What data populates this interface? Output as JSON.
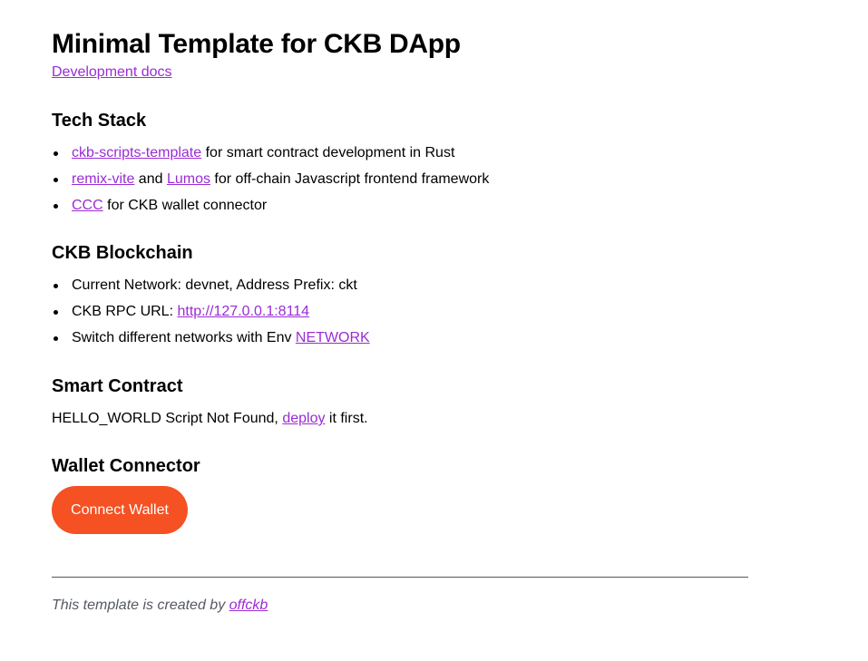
{
  "header": {
    "title": "Minimal Template for CKB DApp",
    "docs_link": "Development docs"
  },
  "tech_stack": {
    "heading": "Tech Stack",
    "items": [
      {
        "link": "ckb-scripts-template",
        "text": " for smart contract development in Rust"
      },
      {
        "link1": "remix-vite",
        "mid": " and ",
        "link2": "Lumos",
        "text": " for off-chain Javascript frontend framework"
      },
      {
        "link": "CCC",
        "text": " for CKB wallet connector"
      }
    ]
  },
  "blockchain": {
    "heading": "CKB Blockchain",
    "items": [
      {
        "text": "Current Network: devnet, Address Prefix: ckt"
      },
      {
        "text": "CKB RPC URL: ",
        "link": "http://127.0.0.1:8114"
      },
      {
        "text": "Switch different networks with Env ",
        "link": "NETWORK"
      }
    ]
  },
  "smart_contract": {
    "heading": "Smart Contract",
    "text_before": "HELLO_WORLD Script Not Found, ",
    "link": "deploy",
    "text_after": " it first."
  },
  "wallet": {
    "heading": "Wallet Connector",
    "button_label": "Connect Wallet"
  },
  "footer": {
    "text": "This template is created by ",
    "link": "offckb"
  },
  "colors": {
    "link": "#9A2CD4",
    "button": "#F55123",
    "footer_text": "#555a61"
  }
}
